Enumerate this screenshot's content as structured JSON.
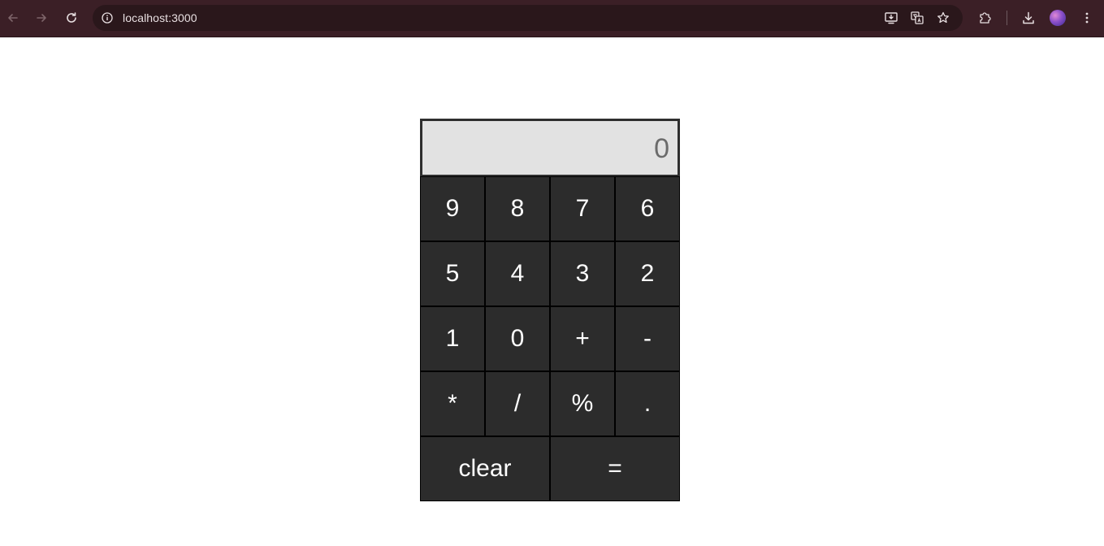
{
  "browser": {
    "url": "localhost:3000",
    "icons": {
      "back": "arrow-left-icon",
      "forward": "arrow-right-icon",
      "reload": "reload-icon",
      "site_info": "info-icon",
      "install": "install-app-icon",
      "translate": "translate-icon",
      "bookmark": "star-icon",
      "extensions": "puzzle-icon",
      "downloads": "download-icon",
      "profile": "avatar",
      "menu": "more-vertical-icon"
    },
    "colors": {
      "toolbar": "#3b1f26",
      "omnibox": "#2a171b"
    }
  },
  "calculator": {
    "display_value": "0",
    "keys": [
      {
        "label": "9"
      },
      {
        "label": "8"
      },
      {
        "label": "7"
      },
      {
        "label": "6"
      },
      {
        "label": "5"
      },
      {
        "label": "4"
      },
      {
        "label": "3"
      },
      {
        "label": "2"
      },
      {
        "label": "1"
      },
      {
        "label": "0"
      },
      {
        "label": "+"
      },
      {
        "label": "-"
      },
      {
        "label": "*"
      },
      {
        "label": "/"
      },
      {
        "label": "%"
      },
      {
        "label": "."
      }
    ],
    "clear_label": "clear",
    "equals_label": "=",
    "colors": {
      "key_bg": "#2c2c2c",
      "key_text": "#ffffff",
      "display_bg": "#e2e2e2",
      "display_text": "#6b6b6b"
    }
  }
}
